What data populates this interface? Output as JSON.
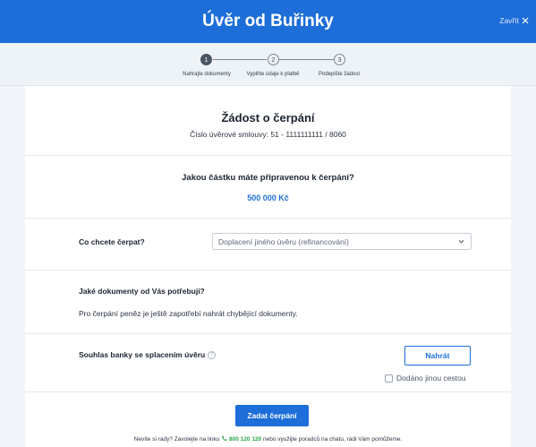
{
  "header": {
    "title": "Úvěr od Buřinky",
    "close_label": "Zavřít"
  },
  "stepper": {
    "steps": [
      {
        "number": "1",
        "label": "Nahrajte dokumenty"
      },
      {
        "number": "2",
        "label": "Vyplňte údaje k platbě"
      },
      {
        "number": "3",
        "label": "Podepište žádost"
      }
    ]
  },
  "request": {
    "title": "Žádost o čerpání",
    "contract_label": "Číslo úvěrové smlouvy:",
    "contract_number": "51 - 1111111111 / 8060"
  },
  "amount": {
    "question": "Jakou částku máte připravenou k čerpání?",
    "value": "500 000 Kč"
  },
  "purpose": {
    "label": "Co chcete čerpat?",
    "selected": "Doplacení jiného úvěru (refinancování)"
  },
  "documents": {
    "title": "Jaké dokumenty od Vás potřebuji?",
    "text": "Pro čerpání peněz je ještě zapotřebí nahrát chybějící dokumenty."
  },
  "consent": {
    "label": "Souhlas banky se splacením úvěru",
    "upload_label": "Nahrát",
    "alt_label": "Dodáno jinou cestou"
  },
  "actions": {
    "submit_label": "Zadat čerpání"
  },
  "help": {
    "before": "Nevíte si rady? Zavolejte na linku",
    "phone": "800 120 120",
    "after": "nebo využijte poradců na chatu, rádi Vám pomůžeme."
  },
  "colors": {
    "brand": "#1d6ed8",
    "phone": "#2aa34a"
  }
}
